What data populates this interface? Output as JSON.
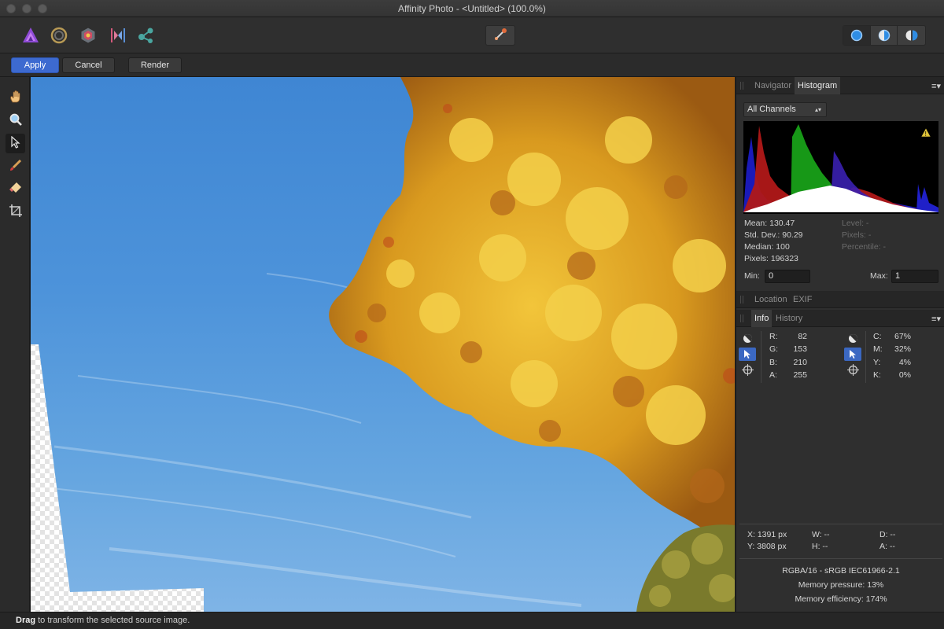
{
  "window": {
    "title": "Affinity Photo - <Untitled> (100.0%)"
  },
  "toolbar": {
    "personas": [
      "photo-persona-icon",
      "liquify-persona-icon",
      "develop-persona-icon",
      "tone-mapping-persona-icon",
      "export-persona-icon"
    ],
    "center_tool": "source-transform-icon",
    "view_modes": [
      "single-view-icon",
      "split-view-icon",
      "mirror-view-icon"
    ]
  },
  "context_toolbar": {
    "apply_label": "Apply",
    "cancel_label": "Cancel",
    "render_label": "Render"
  },
  "tools": [
    "hand-icon",
    "zoom-icon",
    "move-icon",
    "brush-icon",
    "eraser-icon",
    "crop-icon"
  ],
  "panels": {
    "top_tabs": {
      "navigator": "Navigator",
      "histogram": "Histogram"
    },
    "histogram": {
      "channel": "All Channels",
      "mean": "Mean: 130.47",
      "std_dev": "Std. Dev.: 90.29",
      "median": "Median: 100",
      "pixels": "Pixels: 196323",
      "level": "Level: -",
      "pixels_right": "Pixels: -",
      "percentile": "Percentile: -",
      "min_label": "Min:",
      "min_value": "0",
      "max_label": "Max:",
      "max_value": "1"
    },
    "mid_tabs": {
      "location": "Location",
      "exif": "EXIF"
    },
    "info_tabs": {
      "info": "Info",
      "history": "History"
    },
    "info": {
      "rgb": [
        {
          "label": "R:",
          "value": "82"
        },
        {
          "label": "G:",
          "value": "153"
        },
        {
          "label": "B:",
          "value": "210"
        },
        {
          "label": "A:",
          "value": "255"
        }
      ],
      "cmyk": [
        {
          "label": "C:",
          "value": "67%"
        },
        {
          "label": "M:",
          "value": "32%"
        },
        {
          "label": "Y:",
          "value": "4%"
        },
        {
          "label": "K:",
          "value": "0%"
        }
      ],
      "x": "X: 1391 px",
      "y": "Y: 3808 px",
      "w": "W: --",
      "h": "H: --",
      "d": "D: --",
      "a": "A: --",
      "color_format": "RGBA/16 - sRGB IEC61966-2.1",
      "memory_pressure": "Memory pressure: 13%",
      "memory_efficiency": "Memory efficiency: 174%"
    }
  },
  "status": {
    "bold": "Drag",
    "text": " to transform the selected source image."
  },
  "colors": {
    "accent": "#3d6ad0",
    "selected_icon": "#3b68c2"
  }
}
